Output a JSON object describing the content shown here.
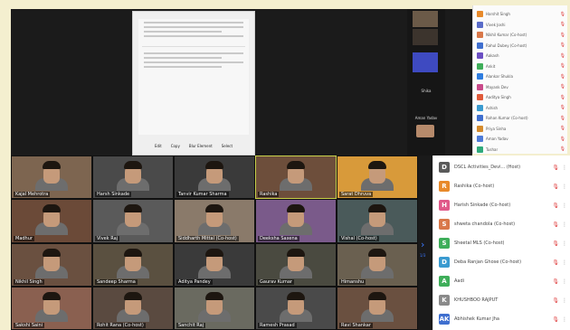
{
  "slide": {
    "title": "",
    "toolbar": [
      "Edit",
      "Copy",
      "Blur Element",
      "Select"
    ]
  },
  "pinned": {
    "labels": [
      "Shika",
      "Aman Yadav"
    ]
  },
  "small_list": [
    {
      "name": "Harshit Singh",
      "color": "#e88a2b"
    },
    {
      "name": "Vivek Joshi",
      "color": "#5a6cc9"
    },
    {
      "name": "Nikhil Kumar (Co-host)",
      "color": "#d9784a"
    },
    {
      "name": "Rahul Dubey (Co-host)",
      "color": "#3f6fcf"
    },
    {
      "name": "Aakash",
      "color": "#6b4fc3"
    },
    {
      "name": "Ankit",
      "color": "#3fae5a"
    },
    {
      "name": "Alankar Shukla",
      "color": "#2f7de0"
    },
    {
      "name": "Mayank Dev",
      "color": "#c94a8a"
    },
    {
      "name": "Aaditya Singh",
      "color": "#e05a3a"
    },
    {
      "name": "Ashish",
      "color": "#3a9bd0"
    },
    {
      "name": "Rohan Kumar (Co-host)",
      "color": "#3f6fcf"
    },
    {
      "name": "Priya Sinha",
      "color": "#d58b2c"
    },
    {
      "name": "Aman Yadav",
      "color": "#4e7bd8"
    },
    {
      "name": "Tushar",
      "color": "#2faa7b"
    }
  ],
  "tiles": [
    {
      "label": "Kajal Mehrotra",
      "bg": "#7d6550"
    },
    {
      "label": "Harsh Sinkade",
      "bg": "#4a4a4a"
    },
    {
      "label": "Tanvir Kumar Sharma",
      "bg": "#3a3a3a"
    },
    {
      "label": "Rashika",
      "bg": "#6d4e3b",
      "hl": true
    },
    {
      "label": "Sarat Dhruva",
      "bg": "#d89a3a"
    },
    {
      "label": "Madhur",
      "bg": "#6b4a38"
    },
    {
      "label": "Vivek Raj",
      "bg": "#5a5a5a"
    },
    {
      "label": "Siddharth Mittal (Co-host)",
      "bg": "#8a7a6a"
    },
    {
      "label": "Deeksha Saxena",
      "bg": "#7a5a8a"
    },
    {
      "label": "Vishal (Co-host)",
      "bg": "#4a5a5a"
    },
    {
      "label": "Nikhil Singh",
      "bg": "#6a5040"
    },
    {
      "label": "Sandeep Sharma",
      "bg": "#5a5040"
    },
    {
      "label": "Aditya Pandey",
      "bg": "#3a3a3a"
    },
    {
      "label": "Gaurav Kumar",
      "bg": "#4a4a40"
    },
    {
      "label": "Himanshu",
      "bg": "#6a6050"
    },
    {
      "label": "Sakshi Saini",
      "bg": "#8a6050"
    },
    {
      "label": "Rohit Rana (Co-host)",
      "bg": "#5a4a40"
    },
    {
      "label": "Sanchit Raj",
      "bg": "#6a6a60"
    },
    {
      "label": "Ramesh Prasad",
      "bg": "#4a4a4a"
    },
    {
      "label": "Ravi Shankar",
      "bg": "#6a5040"
    }
  ],
  "panel": [
    {
      "initial": "D",
      "name": "DSCL Activities_Devi... (Host)",
      "color": "#5a5a5a"
    },
    {
      "initial": "R",
      "name": "Rashika (Co-host)",
      "color": "#e88a2b"
    },
    {
      "initial": "H",
      "name": "Harish Sinkade (Co-host)",
      "color": "#e05a8a"
    },
    {
      "initial": "S",
      "name": "shweta chandola (Co-host)",
      "color": "#d9784a"
    },
    {
      "initial": "S",
      "name": "Sheetal MLS (Co-host)",
      "color": "#3fae5a"
    },
    {
      "initial": "D",
      "name": "Deba Ranjan Ghose (Co-host)",
      "color": "#3a9bd0"
    },
    {
      "initial": "A",
      "name": "Aadi",
      "color": "#3fae5a"
    },
    {
      "initial": "K",
      "name": "KHUSHBOO RAJPUT",
      "color": "#8a8a8a"
    },
    {
      "initial": "AK",
      "name": "Abhishek Kumar Jha",
      "color": "#3f6fcf"
    }
  ],
  "next_label": "1/3"
}
